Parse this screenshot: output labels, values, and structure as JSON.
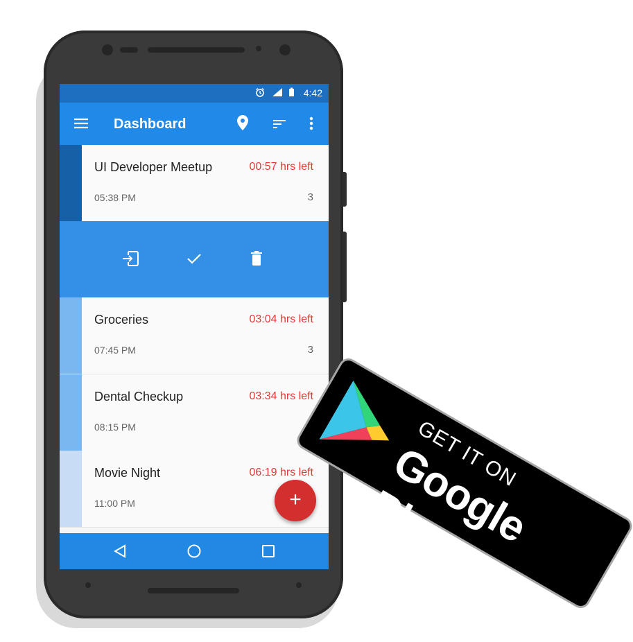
{
  "status_bar": {
    "time": "4:42",
    "icons": [
      "alarm-icon",
      "signal-icon",
      "battery-icon"
    ]
  },
  "app_bar": {
    "title": "Dashboard",
    "icons": [
      "menu-icon",
      "location-icon",
      "sort-icon",
      "more-vert-icon"
    ]
  },
  "tasks": [
    {
      "name": "UI Developer Meetup",
      "time_left": "00:57 hrs left",
      "time": "05:38 PM",
      "count": "3",
      "color": "#1660a8"
    },
    {
      "name": "Groceries",
      "time_left": "03:04 hrs left",
      "time": "07:45 PM",
      "count": "3",
      "color": "#7ab6f0"
    },
    {
      "name": "Dental Checkup",
      "time_left": "03:34 hrs left",
      "time": "08:15 PM",
      "count": "",
      "color": "#7ab6f0"
    },
    {
      "name": "Movie Night",
      "time_left": "06:19 hrs left",
      "time": "11:00 PM",
      "count": "",
      "color": "#c8ddf5"
    }
  ],
  "swipe_actions": [
    "move-icon",
    "check-icon",
    "delete-icon"
  ],
  "fab": {
    "label": "+"
  },
  "navigation": [
    "back-icon",
    "home-icon",
    "recents-icon"
  ],
  "badge": {
    "line1": "GET IT ON",
    "line2": "Google Play"
  },
  "colors": {
    "status_bar": "#1e6fbf",
    "app_bar": "#2189e8",
    "swipe_row": "#348fe6",
    "fab": "#d32f2f",
    "time_left": "#e53935"
  }
}
